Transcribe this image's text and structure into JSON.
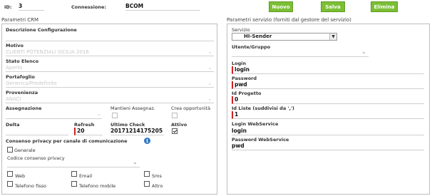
{
  "header": {
    "id_label": "ID:",
    "id_value": "3",
    "connessione_label": "Connessione:",
    "connessione_value": "BCOM",
    "buttons": {
      "nuovo": "Nuovo",
      "salva": "Salva",
      "elimina": "Elimina"
    },
    "button_color": "#7bbf34"
  },
  "crm": {
    "title": "Parametri CRM",
    "descrizione_label": "Descrizione Configurazione",
    "descrizione_value": "",
    "motivo_label": "Motivo",
    "motivo_value": "CLIENTI POTENZIALI SICILIA 2016",
    "stato_label": "Stato Elenco",
    "stato_value": "Aperto",
    "portafoglio_label": "Portafoglio",
    "portafoglio_value": "Generico/Predefinito",
    "provenienza_label": "Provenienza",
    "provenienza_value": "ANACI",
    "assegnazione_label": "Assegnazione",
    "mantieni_label": "Mantieni Assegnaz.",
    "crea_label": "Crea opportunità",
    "delta_label": "Delta",
    "refresh_label": "Refresh",
    "refresh_value": "20",
    "ultimo_label": "Ultimo Check",
    "ultimo_value": "20171214175205",
    "attivo_label": "Attivo",
    "attivo_checked": true,
    "privacy_title": "Consenso privacy per canale di comunicazione",
    "info_icon": "i",
    "generale_label": "Generale",
    "codice_label": "Codice consenso privacy",
    "channels": {
      "web": "Web",
      "email": "Email",
      "sms": "Sms",
      "telefono_fisso": "Telefono fisso",
      "telefono_mobile": "Telefono mobile",
      "altro": "Altro"
    }
  },
  "servizio": {
    "title": "Parametri servizio (forniti dal gestore del servizio)",
    "servizio_label": "Servizio",
    "servizio_value": "HI-Sender",
    "utente_label": "Utente/Gruppo",
    "login_label": "Login",
    "login_value": "login",
    "password_label": "Password",
    "password_value": "pwd",
    "progetto_label": "Id Progetto",
    "progetto_value": "0",
    "liste_label": "Id Liste (suddivisi da ',')",
    "liste_value": "1",
    "login_ws_label": "Login WebService",
    "login_ws_value": "login",
    "password_ws_label": "Password WebService",
    "password_ws_value": "pwd"
  }
}
